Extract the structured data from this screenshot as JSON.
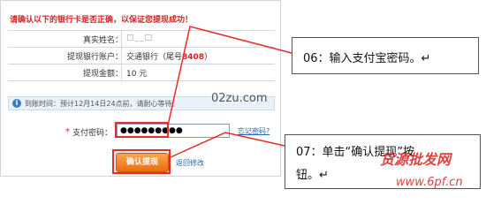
{
  "warning": "请确认以下的银行卡是否正确，以保证您提现成功！",
  "info": {
    "rows": [
      {
        "label": "真实姓名：",
        "value": "□__□"
      },
      {
        "label": "提现银行账户：",
        "value": "交通银行（尾号",
        "suffix": "8408",
        "close": "）"
      },
      {
        "label": "提现金额：",
        "value": "10 元"
      }
    ]
  },
  "notice": {
    "icon": "info-icon",
    "text": "到账时间：预计12月14日24点前，请耐心等待。"
  },
  "password": {
    "required_mark": "*",
    "label": "支付密码：",
    "value": "●●●●●●●●●",
    "forgot": "忘记密码?"
  },
  "buttons": {
    "confirm": "确认提现",
    "back": "返回修改"
  },
  "watermark": "02zu.com",
  "callouts": {
    "step06": "06：输入支付宝密码。↵",
    "step07_line1": "07：单击“确认提现”按",
    "step07_line2": "钮。↵"
  },
  "brand_watermark": {
    "cn": "货源批发网",
    "url": "www.6pf.cn"
  },
  "colors": {
    "accent": "#ec6a0c",
    "warning": "#d62323",
    "link": "#2a66b6",
    "highlight": "#e52b2b"
  }
}
